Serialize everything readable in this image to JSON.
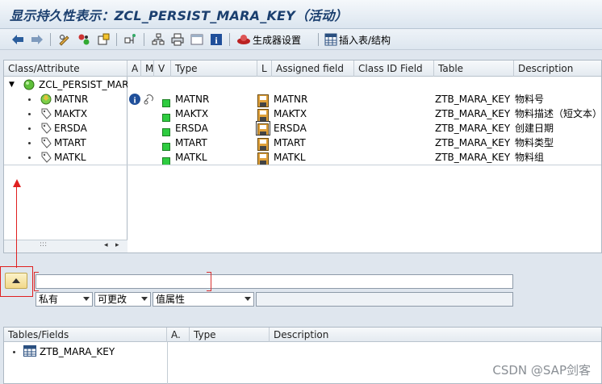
{
  "window": {
    "title": "显示持久性表示：ZCL_PERSIST_MARA_KEY（活动）"
  },
  "toolbar": {
    "back_icon": "arrow-left-icon",
    "forward_icon": "arrow-right-icon",
    "generator_settings_label": "生成器设置",
    "insert_table_label": "插入表/结构"
  },
  "tree": {
    "columns": [
      "Class/Attribute",
      "A",
      "M",
      "V",
      "Type",
      "L",
      "Assigned field",
      "Class ID Field",
      "Table",
      "Description"
    ],
    "class_node": "ZCL_PERSIST_MAR/",
    "rows": [
      {
        "attribute": "MATNR",
        "type": "MATNR",
        "assigned": "MATNR",
        "table": "ZTB_MARA_KEY",
        "description": "物料号",
        "key": true
      },
      {
        "attribute": "MAKTX",
        "type": "MAKTX",
        "assigned": "MAKTX",
        "table": "ZTB_MARA_KEY",
        "description": "物料描述（短文本）",
        "key": false
      },
      {
        "attribute": "ERSDA",
        "type": "ERSDA",
        "assigned": "ERSDA",
        "table": "ZTB_MARA_KEY",
        "description": "创建日期",
        "key": false
      },
      {
        "attribute": "MTART",
        "type": "MTART",
        "assigned": "MTART",
        "table": "ZTB_MARA_KEY",
        "description": "物料类型",
        "key": false
      },
      {
        "attribute": "MATKL",
        "type": "MATKL",
        "assigned": "MATKL",
        "table": "ZTB_MARA_KEY",
        "description": "物料组",
        "key": false
      }
    ],
    "scroll_dots": ":::"
  },
  "detail": {
    "visibility": "私有",
    "changeable": "可更改",
    "attr_kind": "值属性",
    "input_value": "",
    "extra_value": ""
  },
  "tables": {
    "columns": [
      "Tables/Fields",
      "A.",
      "Type",
      "Description"
    ],
    "items": [
      {
        "name": "ZTB_MARA_KEY"
      }
    ]
  },
  "watermark": "CSDN @SAP剑客"
}
